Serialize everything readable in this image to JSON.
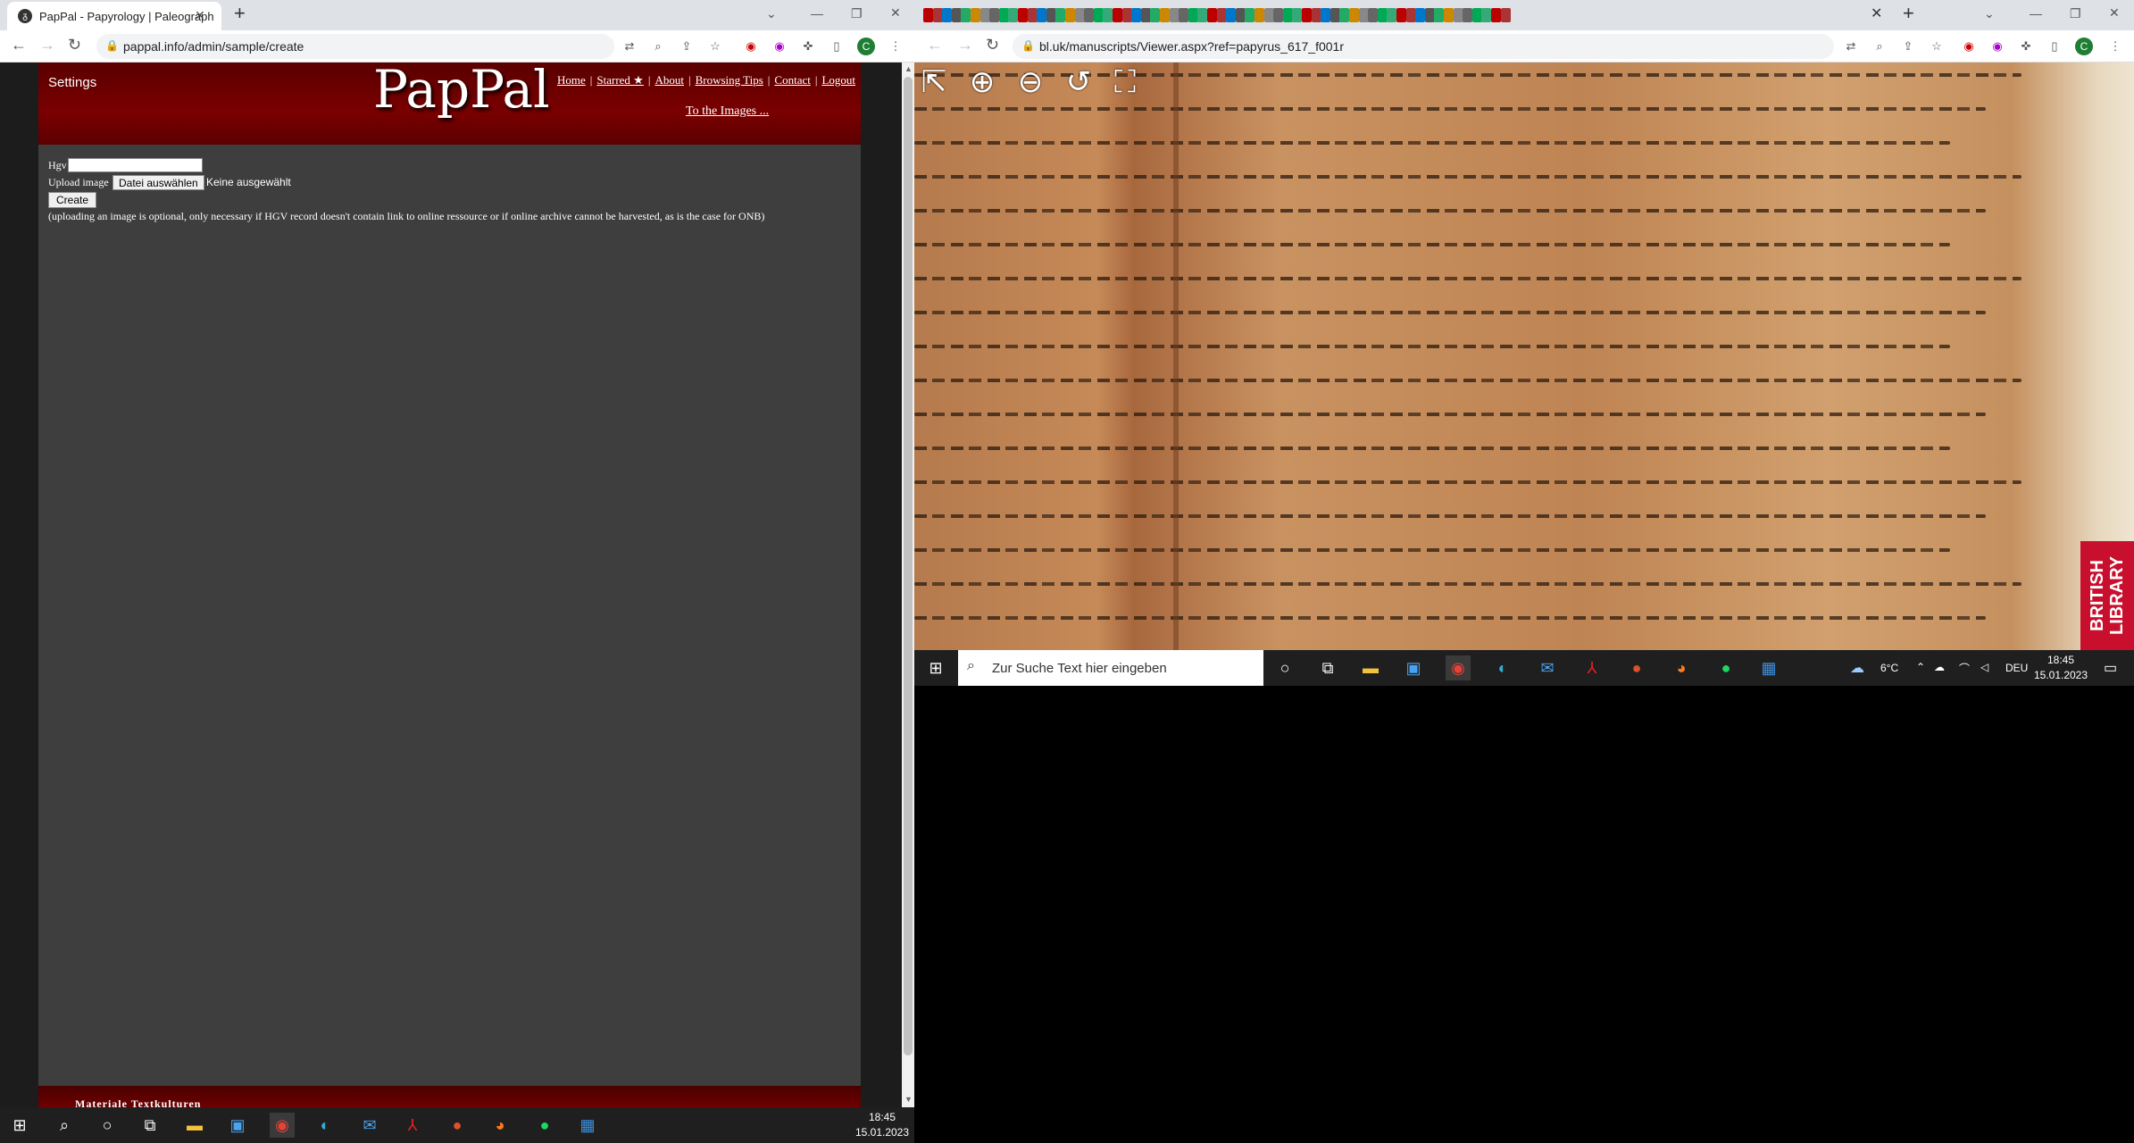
{
  "left_window": {
    "tab_title": "PapPal - Papyrology | Paleograph",
    "url": "pappal.info/admin/sample/create",
    "profile_initial": "C",
    "page": {
      "settings_label": "Settings",
      "logo": "PapPal",
      "nav": [
        "Home",
        "Starred ★",
        "About",
        "Browsing Tips",
        "Contact",
        "Logout"
      ],
      "to_images": "To the Images ...",
      "form": {
        "hgv_label": "Hgv",
        "hgv_value": "",
        "upload_label": "Upload image",
        "file_button": "Datei auswählen",
        "no_file": "Keine ausgewählt",
        "create_button": "Create",
        "note": "(uploading an image is optional, only necessary if HGV record doesn't contain link to online ressource or if online archive cannot be harvested, as is the case for ONB)"
      },
      "footer_text": "Materiale Textkulturen"
    },
    "taskbar": {
      "time": "18:45",
      "date": "15.01.2023",
      "icons": [
        "windows-start-icon",
        "search-icon",
        "cortana-icon",
        "task-view-icon",
        "file-explorer-icon",
        "store-icon",
        "chrome-icon",
        "edge-icon",
        "mail-icon",
        "acrobat-icon",
        "powerpoint-icon",
        "firefox-icon",
        "spotify-icon",
        "photos-icon"
      ]
    }
  },
  "right_window": {
    "url": "bl.uk/manuscripts/Viewer.aspx?ref=papyrus_617_f001r",
    "profile_initial": "C",
    "viewer_tools": [
      "exit-icon",
      "zoom-in-icon",
      "zoom-out-icon",
      "rotate-icon",
      "fit-icon"
    ],
    "logo_text": "BRITISH LIBRARY",
    "taskbar": {
      "search_placeholder": "Zur Suche Text hier eingeben",
      "weather": "6°C",
      "language": "DEU",
      "time": "18:45",
      "date": "15.01.2023"
    }
  },
  "colors": {
    "header_red": "#7a0000",
    "page_gray": "#3e3e3e",
    "taskbar": "#1f1f1f"
  }
}
